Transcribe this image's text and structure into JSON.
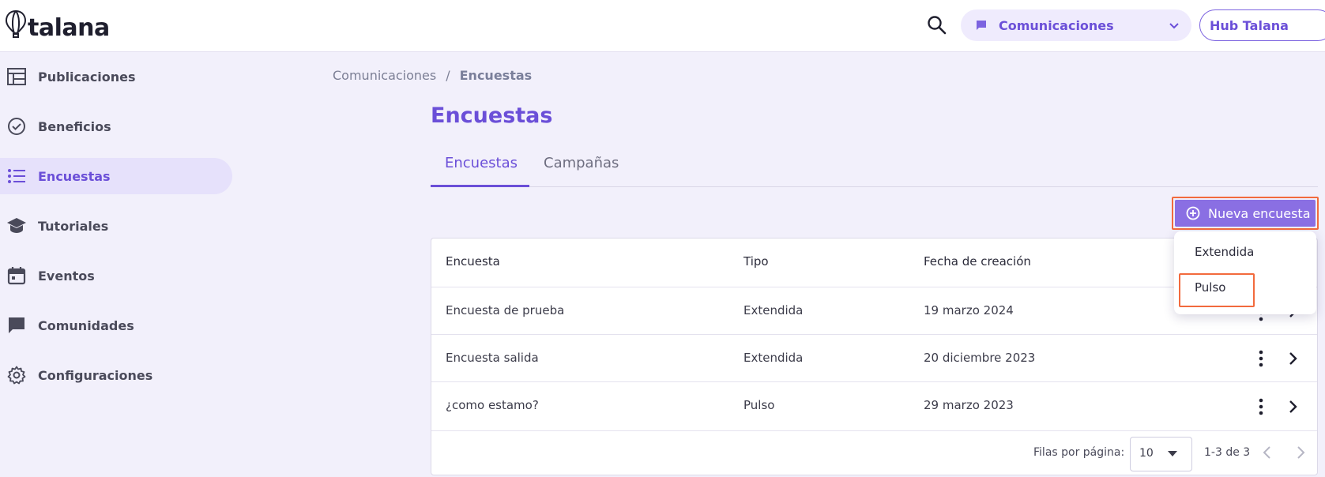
{
  "header": {
    "logo_text": "talana",
    "module_label": "Comunicaciones",
    "hub_label": "Hub Talana"
  },
  "sidebar": {
    "items": [
      {
        "label": "Publicaciones",
        "icon": "publications-icon"
      },
      {
        "label": "Beneficios",
        "icon": "check-circle-icon"
      },
      {
        "label": "Encuestas",
        "icon": "list-icon",
        "active": true
      },
      {
        "label": "Tutoriales",
        "icon": "graduation-cap-icon"
      },
      {
        "label": "Eventos",
        "icon": "calendar-icon"
      },
      {
        "label": "Comunidades",
        "icon": "chat-bubble-icon"
      },
      {
        "label": "Configuraciones",
        "icon": "gear-icon"
      }
    ]
  },
  "breadcrumb": {
    "parent": "Comunicaciones",
    "separator": "/",
    "current": "Encuestas"
  },
  "page": {
    "title": "Encuestas"
  },
  "tabs": [
    {
      "label": "Encuestas",
      "active": true
    },
    {
      "label": "Campañas",
      "active": false
    }
  ],
  "actions": {
    "new_survey": "Nueva encuesta"
  },
  "menu": {
    "items": [
      "Extendida",
      "Pulso"
    ],
    "highlighted": "Pulso"
  },
  "table": {
    "columns": [
      "Encuesta",
      "Tipo",
      "Fecha de creación"
    ],
    "rows": [
      {
        "name": "Encuesta de prueba",
        "type": "Extendida",
        "date": "19 marzo 2024"
      },
      {
        "name": "Encuesta salida",
        "type": "Extendida",
        "date": "20 diciembre 2023"
      },
      {
        "name": "¿como estamo?",
        "type": "Pulso",
        "date": "29 marzo 2023"
      }
    ]
  },
  "pagination": {
    "rows_label": "Filas por página:",
    "rows_per_page": "10",
    "range": "1-3 de 3"
  },
  "colors": {
    "accent": "#6b4fd8",
    "highlight": "#f26a3d",
    "background": "#f2f0fb"
  }
}
